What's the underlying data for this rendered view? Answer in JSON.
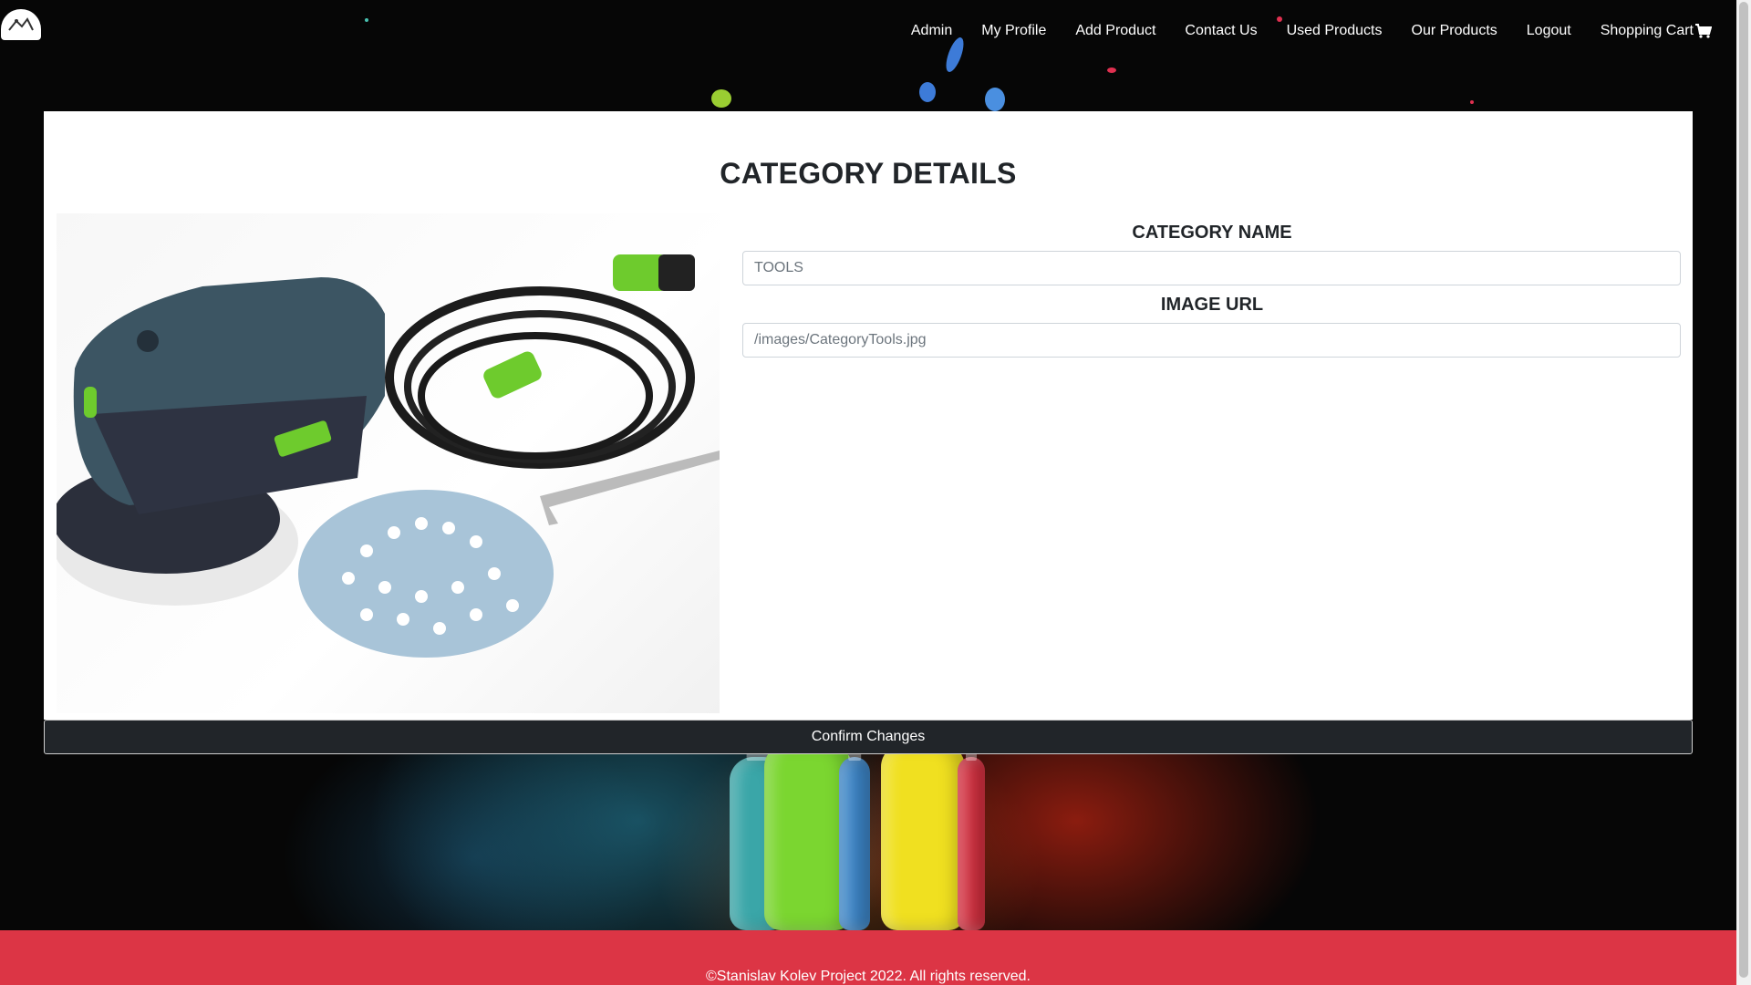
{
  "nav": {
    "links": [
      {
        "label": "Admin"
      },
      {
        "label": "My Profile"
      },
      {
        "label": "Add Product"
      },
      {
        "label": "Contact Us"
      },
      {
        "label": "Used Products"
      },
      {
        "label": "Our Products"
      },
      {
        "label": "Logout"
      },
      {
        "label": "Shopping Cart"
      }
    ],
    "cart_icon": "shopping-cart-icon"
  },
  "page": {
    "title": "CATEGORY DETAILS"
  },
  "form": {
    "category_name_label": "CATEGORY NAME",
    "category_name_value": "TOOLS",
    "image_url_label": "IMAGE URL",
    "image_url_value": "/images/CategoryTools.jpg"
  },
  "actions": {
    "confirm_label": "Confirm Changes"
  },
  "footer": {
    "copyright": "©Stanislav Kolev Project 2022. All rights reserved."
  },
  "colors": {
    "footer": "#dc3545",
    "button": "#212529",
    "text": "#212529"
  }
}
